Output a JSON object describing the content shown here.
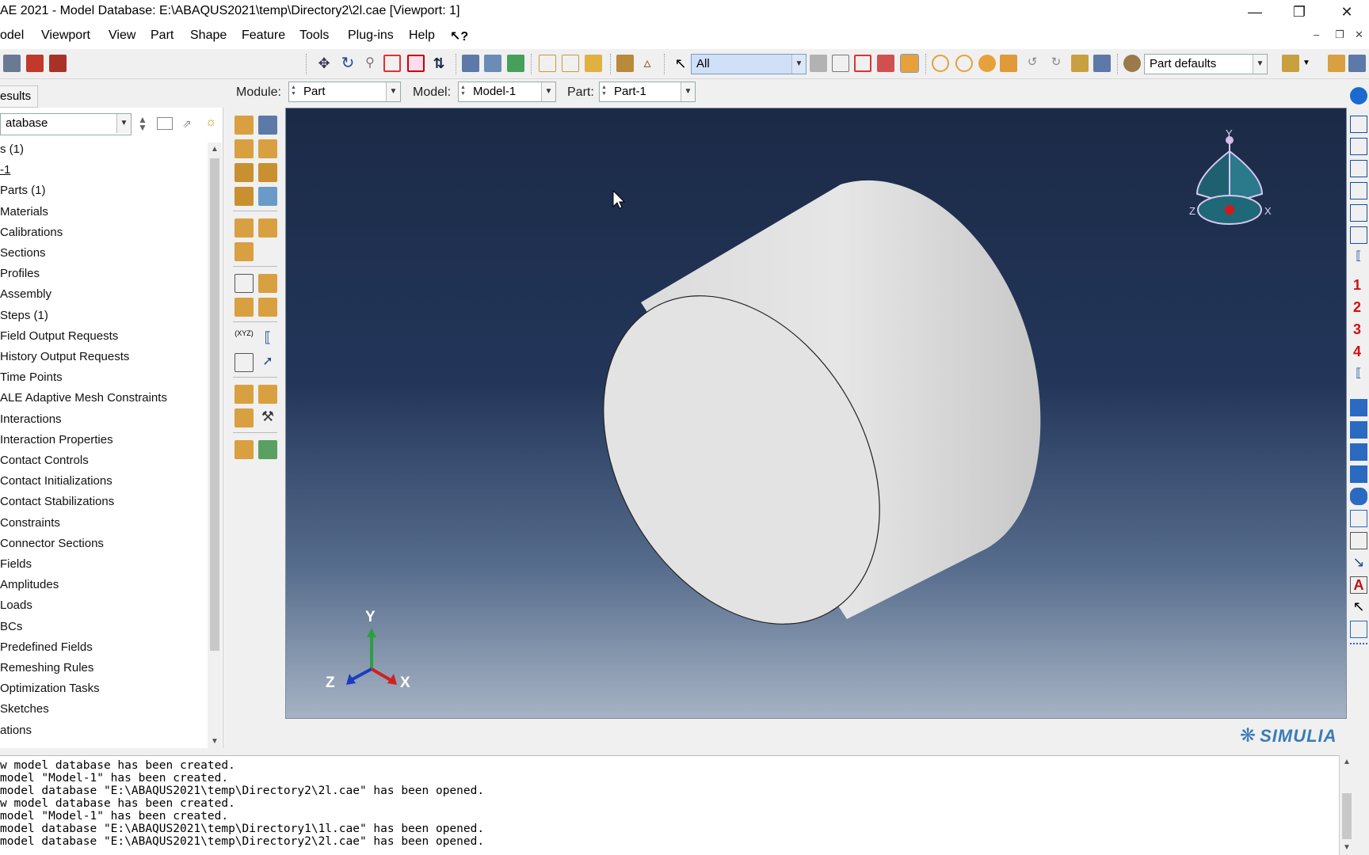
{
  "window": {
    "title": "AE 2021 - Model Database: E:\\ABAQUS2021\\temp\\Directory2\\2l.cae [Viewport: 1]",
    "controls": [
      "minimize-icon",
      "restore-icon",
      "close-icon"
    ]
  },
  "menubar": {
    "items": [
      "odel",
      "Viewport",
      "View",
      "Part",
      "Shape",
      "Feature",
      "Tools",
      "Plug-ins",
      "Help",
      "↖?"
    ]
  },
  "toolbar": {
    "selection_filter": "All",
    "render_style": "Part defaults"
  },
  "context": {
    "module_label": "Module:",
    "module_value": "Part",
    "model_label": "Model:",
    "model_value": "Model-1",
    "part_label": "Part:",
    "part_value": "Part-1"
  },
  "tree": {
    "tab_label": "esults",
    "db_combo": "atabase",
    "items": [
      "s (1)",
      "-1",
      "Parts (1)",
      "Materials",
      "Calibrations",
      "Sections",
      "Profiles",
      "Assembly",
      "Steps (1)",
      "Field Output Requests",
      "History Output Requests",
      "Time Points",
      "ALE Adaptive Mesh Constraints",
      "Interactions",
      "Interaction Properties",
      "Contact Controls",
      "Contact Initializations",
      "Contact Stabilizations",
      "Constraints",
      "Connector Sections",
      "Fields",
      "Amplitudes",
      "Loads",
      "BCs",
      "Predefined Fields",
      "Remeshing Rules",
      "Optimization Tasks",
      "Sketches",
      "ations"
    ]
  },
  "viewport": {
    "triad_large": {
      "y": "Y",
      "z": "Z",
      "x": "X"
    },
    "triad_small": {
      "y": "Y",
      "z": "Z",
      "x": "X"
    },
    "brand": "SIMULIA"
  },
  "right_panel": {
    "numbers": [
      "1",
      "2",
      "3",
      "4"
    ]
  },
  "messages": [
    "w model database has been created.",
    "model \"Model-1\" has been created.",
    "model database \"E:\\ABAQUS2021\\temp\\Directory2\\2l.cae\" has been opened.",
    "w model database has been created.",
    "model \"Model-1\" has been created.",
    "model database \"E:\\ABAQUS2021\\temp\\Directory1\\1l.cae\" has been opened.",
    "model database \"E:\\ABAQUS2021\\temp\\Directory2\\2l.cae\" has been opened."
  ],
  "colors": {
    "viewport_top": "#1b2a46",
    "viewport_bottom": "#a6b3c4",
    "brand": "#3a7bb8",
    "highlight_combo": "#cfe0f7",
    "view_number": "#d01010"
  }
}
